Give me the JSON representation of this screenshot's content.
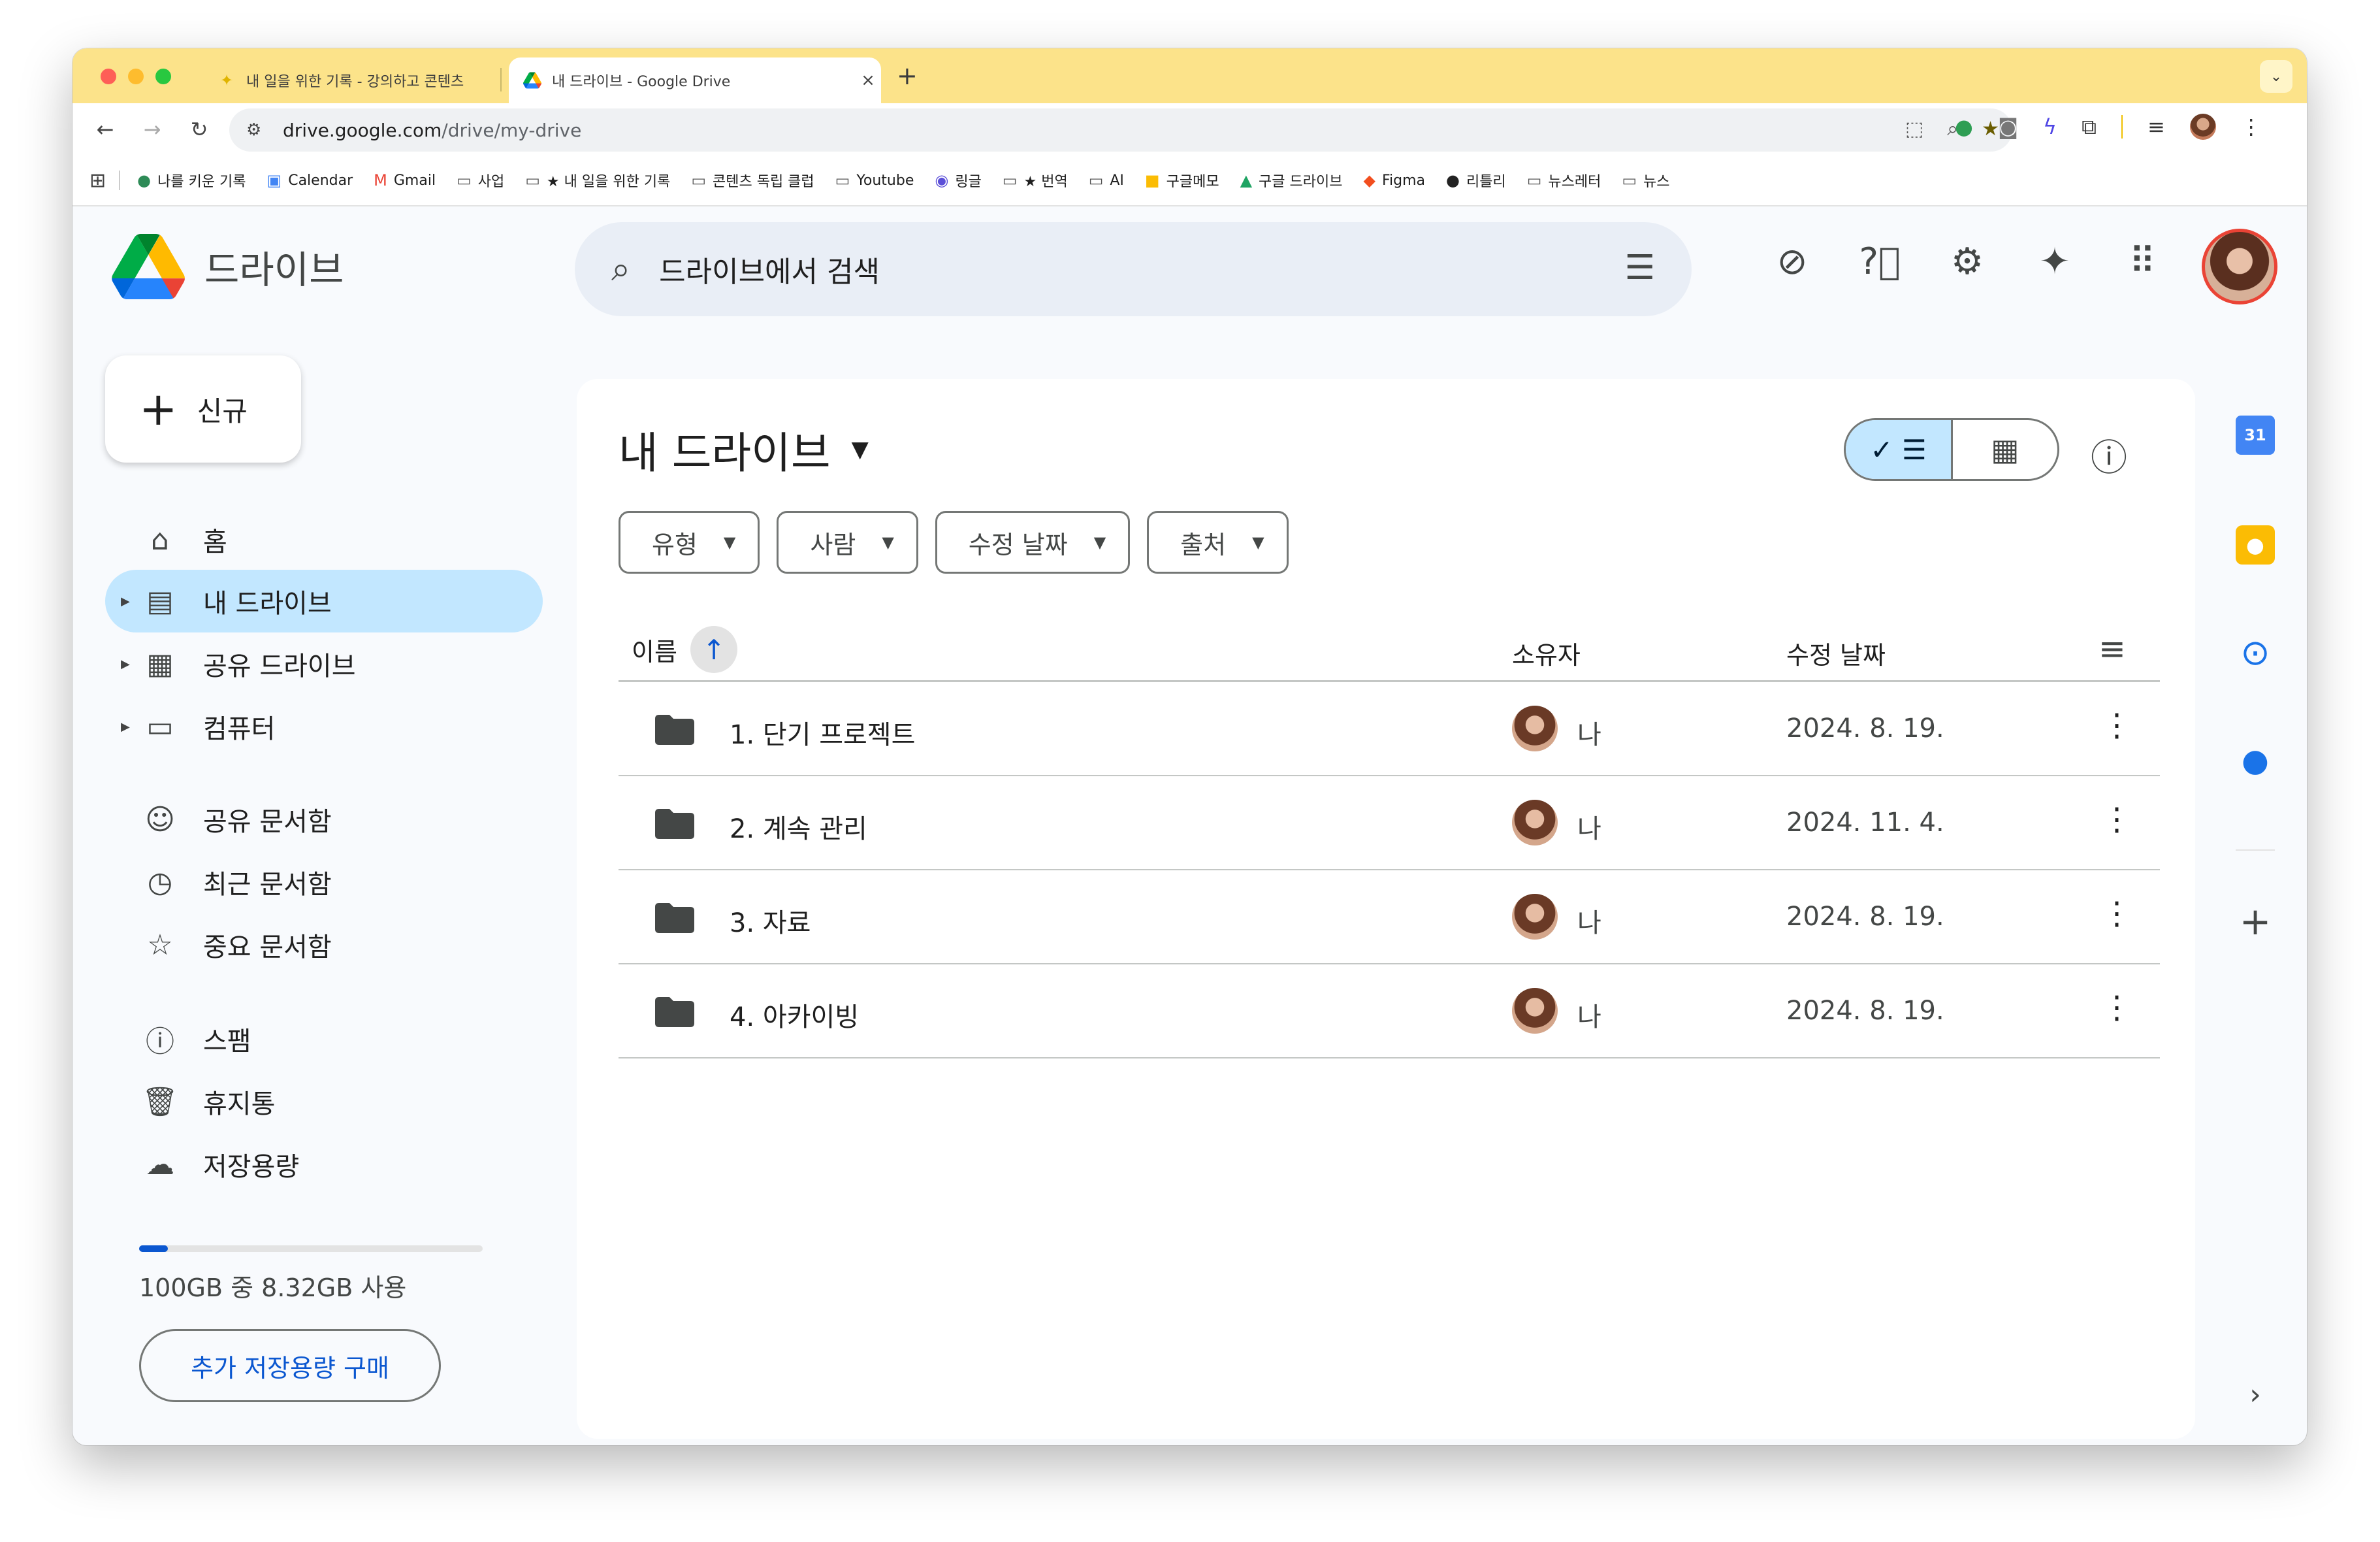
{
  "browser": {
    "tabs": [
      {
        "title": "내 일을 위한 기록 - 강의하고 콘텐츠",
        "favicon": "star-icon",
        "active": false
      },
      {
        "title": "내 드라이브 - Google Drive",
        "favicon": "google-drive-icon",
        "active": true
      }
    ],
    "url_host": "drive.google.com",
    "url_path": "/drive/my-drive",
    "bookmarks": [
      {
        "label": "나를 키운 기록",
        "icon": "globe-icon"
      },
      {
        "label": "Calendar",
        "icon": "calendar-icon"
      },
      {
        "label": "Gmail",
        "icon": "gmail-icon"
      },
      {
        "label": "사업",
        "icon": "folder-icon"
      },
      {
        "label": "★ 내 일을 위한 기록",
        "icon": "folder-icon"
      },
      {
        "label": "콘텐츠 독립 클럽",
        "icon": "folder-icon"
      },
      {
        "label": "Youtube",
        "icon": "folder-icon"
      },
      {
        "label": "링글",
        "icon": "ringle-icon"
      },
      {
        "label": "★ 번역",
        "icon": "folder-icon"
      },
      {
        "label": "AI",
        "icon": "folder-icon"
      },
      {
        "label": "구글메모",
        "icon": "keep-icon"
      },
      {
        "label": "구글 드라이브",
        "icon": "drive-icon"
      },
      {
        "label": "Figma",
        "icon": "figma-icon"
      },
      {
        "label": "리틀리",
        "icon": "litly-icon"
      },
      {
        "label": "뉴스레터",
        "icon": "folder-icon"
      },
      {
        "label": "뉴스",
        "icon": "folder-icon"
      }
    ]
  },
  "drive": {
    "app_name": "드라이브",
    "search_placeholder": "드라이브에서 검색",
    "new_label": "신규",
    "nav": [
      {
        "label": "홈",
        "icon": "home-icon"
      },
      {
        "label": "내 드라이브",
        "icon": "my-drive-icon",
        "selected": true
      },
      {
        "label": "공유 드라이브",
        "icon": "shared-drive-icon"
      },
      {
        "label": "컴퓨터",
        "icon": "computer-icon"
      },
      {
        "label": "공유 문서함",
        "icon": "people-icon"
      },
      {
        "label": "최근 문서함",
        "icon": "clock-icon"
      },
      {
        "label": "중요 문서함",
        "icon": "star-icon"
      },
      {
        "label": "스팸",
        "icon": "spam-icon"
      },
      {
        "label": "휴지통",
        "icon": "trash-icon"
      },
      {
        "label": "저장용량",
        "icon": "cloud-icon"
      }
    ],
    "storage": {
      "text": "100GB 중 8.32GB 사용",
      "used_fraction": 0.0832,
      "buy_label": "추가 저장용량 구매"
    },
    "panel_title": "내 드라이브",
    "filters": [
      "유형",
      "사람",
      "수정 날짜",
      "출처"
    ],
    "columns": {
      "name": "이름",
      "owner": "소유자",
      "modified": "수정 날짜"
    },
    "files": [
      {
        "name": "1. 단기 프로젝트",
        "owner": "나",
        "modified": "2024. 8. 19."
      },
      {
        "name": "2. 계속 관리",
        "owner": "나",
        "modified": "2024. 11. 4."
      },
      {
        "name": "3. 자료",
        "owner": "나",
        "modified": "2024. 8. 19."
      },
      {
        "name": "4. 아카이빙",
        "owner": "나",
        "modified": "2024. 8. 19."
      }
    ],
    "calendar_day": "31"
  },
  "colors": {
    "tabstrip": "#fce38a",
    "selected_nav": "#c2e7ff",
    "search_bg": "#e9eef6",
    "accent": "#0b57d0"
  }
}
